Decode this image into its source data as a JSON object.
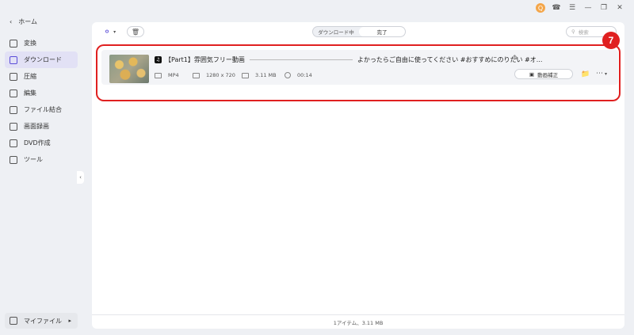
{
  "titlebar": {
    "avatar_label": "Q",
    "icons": [
      "headset-icon",
      "menu-icon",
      "minimize-icon",
      "restore-icon",
      "close-icon"
    ]
  },
  "sidebar": {
    "home_label": "ホーム",
    "items": [
      {
        "label": "変換",
        "icon": "convert-icon",
        "active": false
      },
      {
        "label": "ダウンロード",
        "icon": "download-icon",
        "active": true
      },
      {
        "label": "圧縮",
        "icon": "compress-icon",
        "active": false
      },
      {
        "label": "編集",
        "icon": "edit-scissors-icon",
        "active": false
      },
      {
        "label": "ファイル結合",
        "icon": "merge-icon",
        "active": false
      },
      {
        "label": "画面録画",
        "icon": "screen-record-icon",
        "active": false
      },
      {
        "label": "DVD作成",
        "icon": "dvd-icon",
        "active": false
      },
      {
        "label": "ツール",
        "icon": "tools-icon",
        "active": false
      }
    ],
    "my_files_label": "マイファイル"
  },
  "toolbar": {
    "tabs": [
      {
        "label": "ダウンロード中",
        "active": false
      },
      {
        "label": "完了",
        "active": true
      }
    ],
    "search_placeholder": "検索"
  },
  "items": [
    {
      "title_prefix": "【Part1】雰囲気フリー動画",
      "title_suffix": "よかったらご自由に使ってください #おすすめにのりたい #オ...",
      "format": "MP4",
      "resolution": "1280 x 720",
      "size": "3.11 MB",
      "duration": "00:14",
      "fix_button_label": "動画補正"
    }
  ],
  "annotation": {
    "badge": "7",
    "color": "#e02020"
  },
  "footer": {
    "summary": "1アイテム、3.11 MB"
  },
  "colors": {
    "accent": "#5b4dd8",
    "active_bg": "#e2e1f5"
  }
}
